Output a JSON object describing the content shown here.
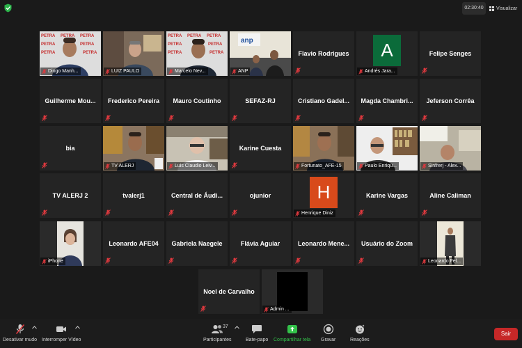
{
  "top_bar": {
    "timer": "02:30:40",
    "view_label": "Visualizar"
  },
  "participants": [
    {
      "name": "Diogo Manh...",
      "type": "video"
    },
    {
      "name": "LUIZ PAULO",
      "type": "video"
    },
    {
      "name": "Marcelo Nev...",
      "type": "video"
    },
    {
      "name": "ANP",
      "type": "video",
      "logo_text": "anp"
    },
    {
      "name": "Flavio Rodrigues",
      "type": "name"
    },
    {
      "name": "Andrés Jara...",
      "type": "avatar",
      "initial": "A",
      "avatar_color": "#0b6b3a"
    },
    {
      "name": "Felipe Senges",
      "type": "name"
    },
    {
      "name": "Guilherme  Mou...",
      "type": "name"
    },
    {
      "name": "Frederico Pereira",
      "type": "name"
    },
    {
      "name": "Mauro Coutinho",
      "type": "name"
    },
    {
      "name": "SEFAZ-RJ",
      "type": "name"
    },
    {
      "name": "Cristiano  Gadel...",
      "type": "name"
    },
    {
      "name": "Magda  Chambri...",
      "type": "name"
    },
    {
      "name": "Jeferson Corrêa",
      "type": "name"
    },
    {
      "name": "bia",
      "type": "name"
    },
    {
      "name": "TV ALERJ",
      "type": "video"
    },
    {
      "name": "Luis Claudio Leiv...",
      "type": "video"
    },
    {
      "name": "Karine Cuesta",
      "type": "name"
    },
    {
      "name": "Fortunato_AFE-15",
      "type": "video",
      "active": true
    },
    {
      "name": "Paulo Enriqu...",
      "type": "video"
    },
    {
      "name": "Sinfrerj - Alex...",
      "type": "video"
    },
    {
      "name": "TV ALERJ 2",
      "type": "name"
    },
    {
      "name": "tvalerj1",
      "type": "name"
    },
    {
      "name": "Central  de  Áudi...",
      "type": "name"
    },
    {
      "name": "ojunior",
      "type": "name"
    },
    {
      "name": "Henrique Diniz",
      "type": "avatar",
      "initial": "H",
      "avatar_color": "#d84a1b"
    },
    {
      "name": "Karine Vargas",
      "type": "name"
    },
    {
      "name": "Aline Caliman",
      "type": "name"
    },
    {
      "name": "iPhone",
      "type": "video"
    },
    {
      "name": "Leonardo AFE04",
      "type": "name"
    },
    {
      "name": "Gabriela Naegele",
      "type": "name"
    },
    {
      "name": "Flávia Aguiar",
      "type": "name"
    },
    {
      "name": "Leonardo  Mene...",
      "type": "name"
    },
    {
      "name": "Usuário do Zoom",
      "type": "name"
    },
    {
      "name": "Leonardo Fel...",
      "type": "video"
    },
    {
      "name": "Noel de Carvalho",
      "type": "name"
    },
    {
      "name": "Admin ...",
      "type": "blank"
    }
  ],
  "toolbar": {
    "mute_label": "Desativar mudo",
    "video_label": "Interromper Vídeo",
    "participants_label": "Participantes",
    "participants_count": "37",
    "chat_label": "Bate-papo",
    "share_label": "Compartilhar tela",
    "record_label": "Gravar",
    "reactions_label": "Reações",
    "leave_label": "Sair"
  },
  "colors": {
    "active_border": "#a7d65a",
    "share_green": "#33c24a",
    "leave_red": "#c62828",
    "muted_red": "#e0393e"
  }
}
